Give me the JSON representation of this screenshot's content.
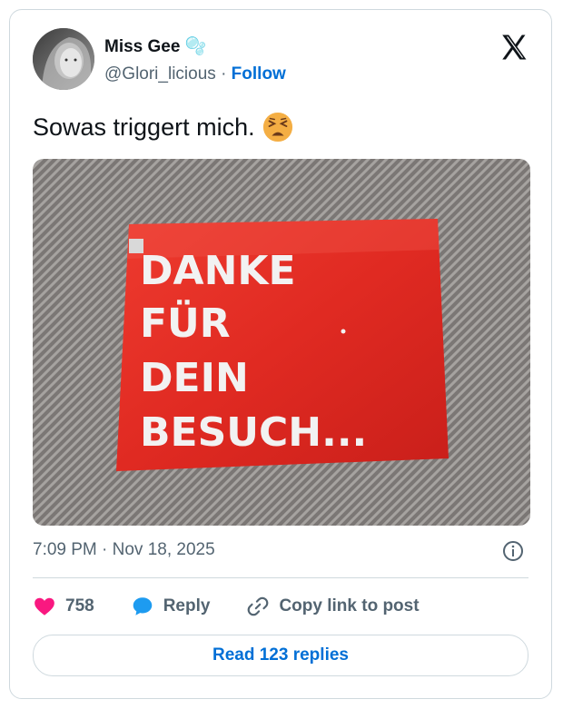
{
  "author": {
    "name": "Miss Gee 🫧",
    "handle": "@Glori_licious",
    "separator": "·",
    "follow_label": "Follow"
  },
  "tweet": {
    "text": "Sowas triggert mich.",
    "emoji": "tired-face-emoji"
  },
  "media": {
    "packet_text_lines": [
      "DANKE",
      "FÜR",
      "DEIN",
      "BESUCH..."
    ],
    "packet_color": "#e8302a",
    "background_color": "#7b7775"
  },
  "meta": {
    "timestamp": "7:09 PM · Nov 18, 2025"
  },
  "actions": {
    "likes_count": "758",
    "reply_label": "Reply",
    "copy_label": "Copy link to post"
  },
  "read_replies_label": "Read 123 replies",
  "colors": {
    "like": "#f91880",
    "reply": "#1d9bf0",
    "link": "#006fd6",
    "secondary": "#536471"
  }
}
